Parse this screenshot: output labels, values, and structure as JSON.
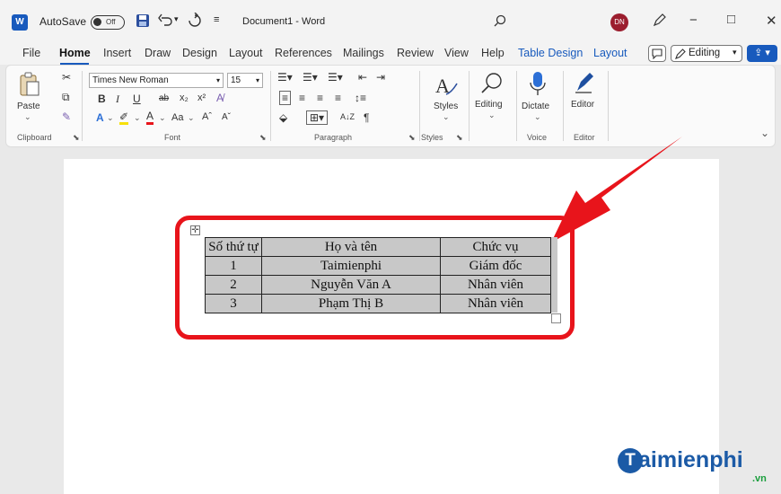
{
  "titlebar": {
    "autosave_label": "AutoSave",
    "autosave_state": "Off",
    "doc_title": "Document1  -  Word",
    "avatar_initials": "DN",
    "undo_icon": "undo-icon",
    "redo_icon": "redo-icon",
    "minimize": "−",
    "maximize": "□",
    "close": "✕"
  },
  "menu": {
    "tabs": [
      "File",
      "Home",
      "Insert",
      "Draw",
      "Design",
      "Layout",
      "References",
      "Mailings",
      "Review",
      "View",
      "Help",
      "Table Design",
      "Layout"
    ],
    "active": "Home",
    "editing_label": "Editing",
    "comment_icon": "comment-icon"
  },
  "ribbon": {
    "clipboard": {
      "paste": "Paste",
      "group": "Clipboard"
    },
    "font": {
      "name": "Times New Roman",
      "size": "15",
      "bold": "B",
      "italic": "I",
      "underline": "U",
      "strike": "ab",
      "subscript": "x₂",
      "superscript": "x²",
      "case": "Aa",
      "grow": "Aˆ",
      "shrink": "Aˇ",
      "group": "Font"
    },
    "paragraph": {
      "group": "Paragraph",
      "pilcrow": "¶",
      "sort": "A↓Z"
    },
    "styles": {
      "label": "Styles",
      "group": "Styles"
    },
    "editing": {
      "label": "Editing"
    },
    "voice": {
      "dictate": "Dictate",
      "group": "Voice"
    },
    "editor": {
      "label": "Editor",
      "group": "Editor"
    }
  },
  "table": {
    "headers": [
      "Số thứ tự",
      "Họ và tên",
      "Chức vụ"
    ],
    "rows": [
      [
        "1",
        "Taimienphi",
        "Giám đốc"
      ],
      [
        "2",
        "Nguyễn Văn A",
        "Nhân viên"
      ],
      [
        "3",
        "Phạm Thị B",
        "Nhân viên"
      ]
    ]
  },
  "watermark": {
    "text": "aimienphi",
    "initial": "T",
    "suffix": ".vn"
  },
  "colors": {
    "accent": "#185abd",
    "highlight": "#e8141b",
    "cell_fill": "#c8c8c8"
  }
}
